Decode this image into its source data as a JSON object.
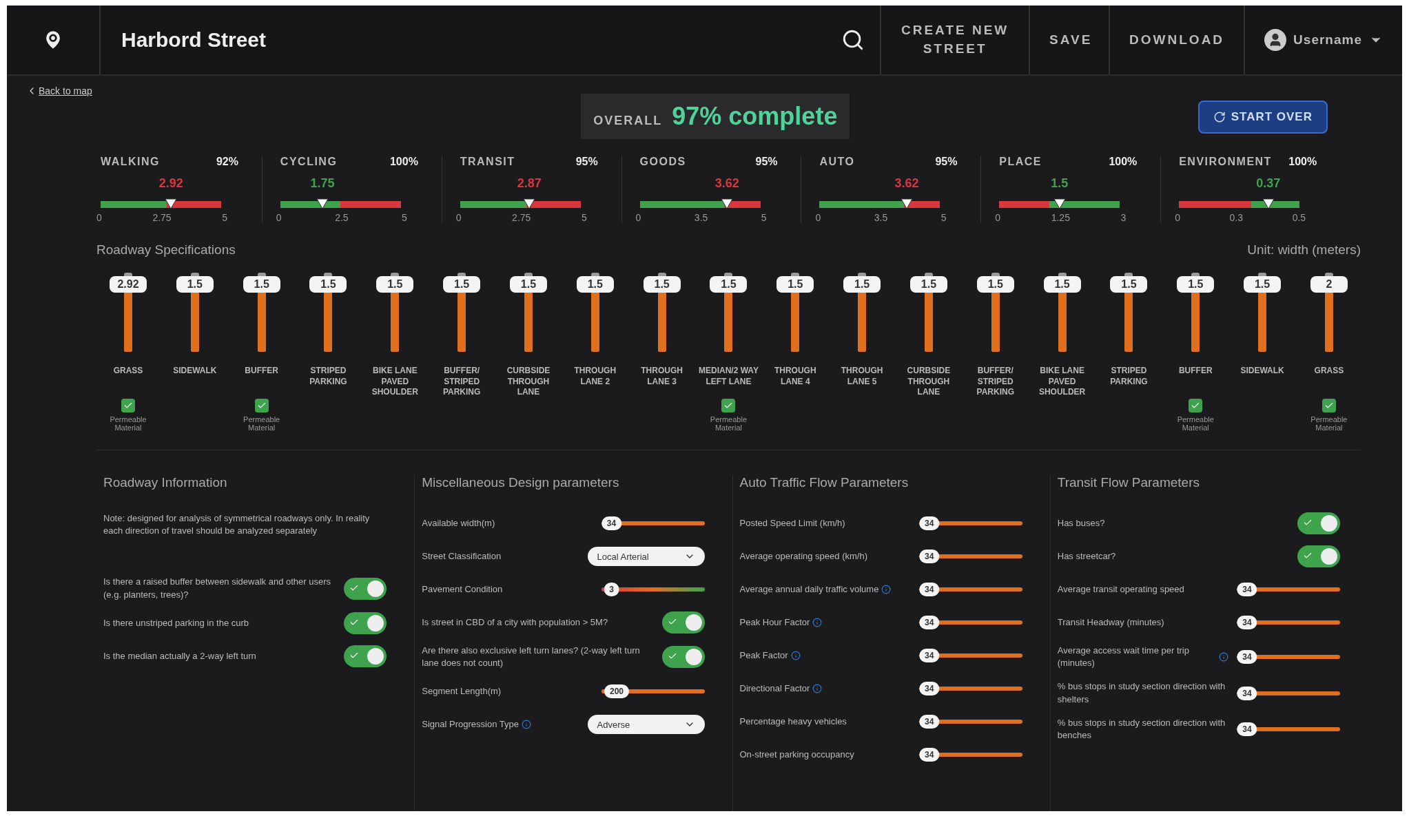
{
  "header": {
    "title": "Harbord Street",
    "actions": [
      "CREATE NEW STREET",
      "SAVE",
      "DOWNLOAD"
    ],
    "user": "Username"
  },
  "back_link": "Back to map",
  "overall": {
    "label": "OVERALL",
    "value": "97% complete"
  },
  "start_over": "START OVER",
  "scores": [
    {
      "label": "WALKING",
      "percent": "92%",
      "value": "2.92",
      "level": 0.584,
      "kind": "falling",
      "ticks": [
        "0",
        "2.75",
        "5"
      ]
    },
    {
      "label": "CYCLING",
      "percent": "100%",
      "value": "1.75",
      "level": 0.35,
      "kind": "falling",
      "ticks": [
        "0",
        "2.5",
        "5"
      ]
    },
    {
      "label": "TRANSIT",
      "percent": "95%",
      "value": "2.87",
      "level": 0.574,
      "kind": "falling",
      "ticks": [
        "0",
        "2.75",
        "5"
      ]
    },
    {
      "label": "GOODS",
      "percent": "95%",
      "value": "3.62",
      "level": 0.724,
      "kind": "falling",
      "ticks": [
        "0",
        "3.5",
        "5"
      ]
    },
    {
      "label": "AUTO",
      "percent": "95%",
      "value": "3.62",
      "level": 0.724,
      "kind": "falling",
      "ticks": [
        "0",
        "3.5",
        "5"
      ]
    },
    {
      "label": "PLACE",
      "percent": "100%",
      "value": "1.5",
      "level": 0.5,
      "kind": "rising",
      "ticks": [
        "0",
        "1.25",
        "3"
      ]
    },
    {
      "label": "ENVIRONMENT",
      "percent": "100%",
      "value": "0.37",
      "level": 0.74,
      "kind": "rising",
      "ticks": [
        "0",
        "0.3",
        "0.5"
      ]
    }
  ],
  "roadway": {
    "title": "Roadway Specifications",
    "unit": "Unit: width (meters)",
    "lanes": [
      {
        "name": "GRASS",
        "value": "2.92",
        "level": 0.85,
        "permeable": true,
        "permeable_label": "Permeable Material"
      },
      {
        "name": "SIDEWALK",
        "value": "1.5",
        "level": 0.85,
        "permeable": false
      },
      {
        "name": "BUFFER",
        "value": "1.5",
        "level": 0.85,
        "permeable": true,
        "permeable_label": "Permeable Material"
      },
      {
        "name": "STRIPED PARKING",
        "value": "1.5",
        "level": 0.85,
        "permeable": false
      },
      {
        "name": "BIKE LANE PAVED SHOULDER",
        "value": "1.5",
        "level": 0.85,
        "permeable": false
      },
      {
        "name": "BUFFER/ STRIPED PARKING",
        "value": "1.5",
        "level": 0.85,
        "permeable": false
      },
      {
        "name": "CURBSIDE THROUGH LANE",
        "value": "1.5",
        "level": 0.85,
        "permeable": false
      },
      {
        "name": "THROUGH LANE 2",
        "value": "1.5",
        "level": 0.85,
        "permeable": false
      },
      {
        "name": "THROUGH LANE 3",
        "value": "1.5",
        "level": 0.85,
        "permeable": false
      },
      {
        "name": "MEDIAN/2 WAY LEFT LANE",
        "value": "1.5",
        "level": 0.85,
        "permeable": true,
        "permeable_label": "Permeable Material"
      },
      {
        "name": "THROUGH LANE 4",
        "value": "1.5",
        "level": 0.85,
        "permeable": false
      },
      {
        "name": "THROUGH LANE 5",
        "value": "1.5",
        "level": 0.85,
        "permeable": false
      },
      {
        "name": "CURBSIDE THROUGH LANE",
        "value": "1.5",
        "level": 0.85,
        "permeable": false
      },
      {
        "name": "BUFFER/ STRIPED PARKING",
        "value": "1.5",
        "level": 0.85,
        "permeable": false
      },
      {
        "name": "BIKE LANE PAVED SHOULDER",
        "value": "1.5",
        "level": 0.85,
        "permeable": false
      },
      {
        "name": "STRIPED PARKING",
        "value": "1.5",
        "level": 0.85,
        "permeable": false
      },
      {
        "name": "BUFFER",
        "value": "1.5",
        "level": 0.85,
        "permeable": true,
        "permeable_label": "Permeable Material"
      },
      {
        "name": "SIDEWALK",
        "value": "1.5",
        "level": 0.85,
        "permeable": false
      },
      {
        "name": "GRASS",
        "value": "2",
        "level": 0.85,
        "permeable": true,
        "permeable_label": "Permeable Material"
      }
    ]
  },
  "panels": [
    {
      "title": "Roadway Information",
      "items": [
        {
          "kind": "note",
          "label": "Note: designed for analysis of symmetrical roadways only. In reality each direction of travel should be analyzed separately"
        },
        {
          "kind": "toggle",
          "label": "Is there a raised buffer between sidewalk and other users (e.g. planters, trees)?",
          "on": true
        },
        {
          "kind": "toggle",
          "label": "Is there unstriped parking in the curb",
          "on": true
        },
        {
          "kind": "toggle",
          "label": "Is the median actually a 2-way left turn",
          "on": true
        }
      ]
    },
    {
      "title": "Miscellaneous Design parameters",
      "items": [
        {
          "kind": "slider",
          "label": "Available width(m)",
          "value": "34",
          "level": 0.1
        },
        {
          "kind": "select",
          "label": "Street Classification",
          "value": "Local Arterial"
        },
        {
          "kind": "gradient",
          "label": "Pavement Condition",
          "value": "3",
          "level": 0.1
        },
        {
          "kind": "toggle",
          "label": "Is street in CBD of a city with population > 5M?",
          "on": true
        },
        {
          "kind": "toggle",
          "label": "Are there also exclusive left turn lanes? (2-way left turn lane does not count)",
          "on": true
        },
        {
          "kind": "slider",
          "label": "Segment Length(m)",
          "value": "200",
          "level": 0.15
        },
        {
          "kind": "select",
          "label": "Signal Progression Type",
          "value": "Adverse",
          "info": true
        }
      ]
    },
    {
      "title": "Auto Traffic Flow Parameters",
      "items": [
        {
          "kind": "slider",
          "label": "Posted Speed Limit (km/h)",
          "value": "34",
          "level": 0.1
        },
        {
          "kind": "slider",
          "label": "Average operating speed (km/h)",
          "value": "34",
          "level": 0.1
        },
        {
          "kind": "slider",
          "label": "Average annual daily traffic volume",
          "value": "34",
          "level": 0.1,
          "info": true
        },
        {
          "kind": "slider",
          "label": "Peak Hour Factor",
          "value": "34",
          "level": 0.1,
          "info": true
        },
        {
          "kind": "slider",
          "label": "Peak Factor",
          "value": "34",
          "level": 0.1,
          "info": true
        },
        {
          "kind": "slider",
          "label": "Directional Factor",
          "value": "34",
          "level": 0.1,
          "info": true
        },
        {
          "kind": "slider",
          "label": "Percentage heavy vehicles",
          "value": "34",
          "level": 0.1
        },
        {
          "kind": "slider",
          "label": "On-street parking occupancy",
          "value": "34",
          "level": 0.1
        }
      ]
    },
    {
      "title": "Transit Flow Parameters",
      "items": [
        {
          "kind": "toggle",
          "label": "Has buses?",
          "on": true
        },
        {
          "kind": "toggle",
          "label": "Has streetcar?",
          "on": true
        },
        {
          "kind": "slider",
          "label": "Average transit operating speed",
          "value": "34",
          "level": 0.1
        },
        {
          "kind": "slider",
          "label": "Transit Headway (minutes)",
          "value": "34",
          "level": 0.1
        },
        {
          "kind": "slider",
          "label": "Average access wait time per trip (minutes)",
          "value": "34",
          "level": 0.1,
          "info": true
        },
        {
          "kind": "slider",
          "label": "% bus stops in study section direction with shelters",
          "value": "34",
          "level": 0.1
        },
        {
          "kind": "slider",
          "label": "% bus stops in study section direction with benches",
          "value": "34",
          "level": 0.1
        }
      ]
    }
  ]
}
